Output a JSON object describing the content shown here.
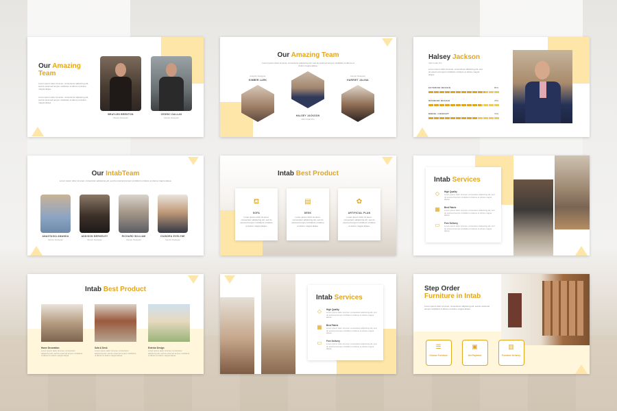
{
  "colors": {
    "accent": "#e2a61c",
    "accent_light": "#fde6a8",
    "text": "#333333"
  },
  "lorem": "Lorem ipsum dolor sit amet, consectetur adipiscing elit, sed do eiusmod tempor incididunt ut labore et dolore magna aliqua.",
  "slide1": {
    "title_a": "Our",
    "title_b": "Amazing",
    "title_c": "Team",
    "members": [
      {
        "name": "BRAYLEN BRENTON",
        "role": "Interior Designer"
      },
      {
        "name": "CEDRIC DALLAS",
        "role": "Interior Designer"
      }
    ]
  },
  "slide2": {
    "title_a": "Our",
    "title_b": "Amazing Team",
    "members": [
      {
        "name": "KIMBER LARK",
        "role": "Graphic Designer"
      },
      {
        "name": "HALSEY JACKSON",
        "role": "CEO Intab Pro"
      },
      {
        "name": "HARRIET JALINA",
        "role": "Interior Designer"
      }
    ]
  },
  "slide3": {
    "name_a": "Halsey",
    "name_b": "Jackson",
    "role": "CEO Intab Pro",
    "skills": [
      {
        "label": "EXTERIOR DESIGN",
        "pct": "80%",
        "value": 80
      },
      {
        "label": "INTERIOR DESIGN",
        "pct": "75%",
        "value": 75
      },
      {
        "label": "MODEL CONCEPT",
        "pct": "70%",
        "value": 70
      }
    ]
  },
  "slide4": {
    "title_a": "Our",
    "title_b": "IntabTeam",
    "members": [
      {
        "name": "ANASTASIA AMANDA",
        "role": "Interior Designer"
      },
      {
        "name": "ADDISON BERKELEY",
        "role": "Interior Designer"
      },
      {
        "name": "RICHARD WILLIAM",
        "role": "Interior Designer"
      },
      {
        "name": "DIANDRA EVELYNE",
        "role": "Interior Designer"
      }
    ]
  },
  "slide5": {
    "title_a": "Intab",
    "title_b": "Best Product",
    "products": [
      {
        "name": "SOFA",
        "icon": "sofa-icon"
      },
      {
        "name": "DESK",
        "icon": "desk-icon"
      },
      {
        "name": "ARTIFICIAL PLAN",
        "icon": "plant-icon"
      }
    ]
  },
  "slide6": {
    "title_a": "Intab",
    "title_b": "Services",
    "services": [
      {
        "name": "High Quality",
        "icon": "diamond-icon"
      },
      {
        "name": "Best Fabric",
        "icon": "fabric-icon"
      },
      {
        "name": "Free Delivery",
        "icon": "truck-icon"
      }
    ]
  },
  "slide7": {
    "title_a": "Intab",
    "title_b": "Best Product",
    "items": [
      {
        "name": "Home Decoration"
      },
      {
        "name": "Sofa & Desk"
      },
      {
        "name": "Exterior Design"
      }
    ]
  },
  "slide8": {
    "title_a": "Intab",
    "title_b": "Services",
    "services": [
      {
        "name": "High Quality",
        "icon": "diamond-icon"
      },
      {
        "name": "Best Fabric",
        "icon": "fabric-icon"
      },
      {
        "name": "Free Delivery",
        "icon": "truck-icon"
      }
    ]
  },
  "slide9": {
    "title_a": "Step Order",
    "title_b": "Furniture in Intab",
    "steps": [
      {
        "label": "Choose Furniture",
        "icon": "choose-icon"
      },
      {
        "label": "Get Payment",
        "icon": "payment-icon"
      },
      {
        "label": "Furniture Delivery",
        "icon": "delivery-icon"
      }
    ]
  }
}
